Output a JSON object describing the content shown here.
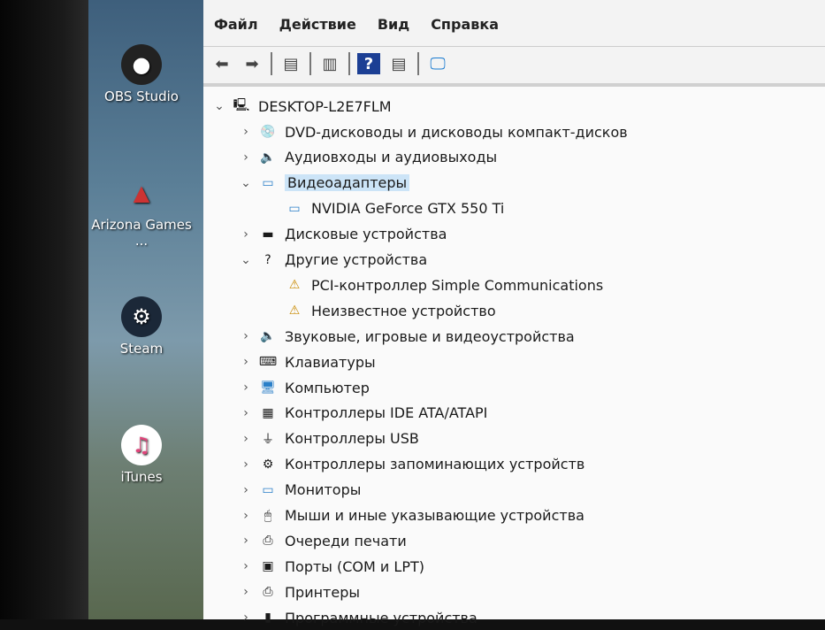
{
  "desktop": {
    "icons": [
      {
        "label": "OBS Studio",
        "icon": "obs-icon"
      },
      {
        "label": "Arizona Games ...",
        "icon": "arizona-icon"
      },
      {
        "label": "Steam",
        "icon": "steam-icon"
      },
      {
        "label": "iTunes",
        "icon": "itunes-icon"
      }
    ]
  },
  "menu": [
    "Файл",
    "Действие",
    "Вид",
    "Справка"
  ],
  "toolbar": [
    "back-icon",
    "forward-icon",
    "properties-icon",
    "show-hide-icon",
    "help-icon",
    "update-driver-icon",
    "scan-hardware-icon"
  ],
  "tree": {
    "root": "DESKTOP-L2E7FLM",
    "rows": [
      {
        "label": "DVD-дисководы и дисководы компакт-дисков",
        "level": 1,
        "expand": "collapsed",
        "icon": "dvd-icon",
        "glyph": "💿"
      },
      {
        "label": "Аудиовходы и аудиовыходы",
        "level": 1,
        "expand": "collapsed",
        "icon": "speaker-icon",
        "glyph": "🔈"
      },
      {
        "label": "Видеоадаптеры",
        "level": 1,
        "expand": "expanded",
        "icon": "display-adapter-icon",
        "glyph": "▭",
        "selected": true
      },
      {
        "label": "NVIDIA GeForce GTX 550 Ti",
        "level": 2,
        "icon": "display-adapter-icon",
        "glyph": "▭"
      },
      {
        "label": "Дисковые устройства",
        "level": 1,
        "expand": "collapsed",
        "icon": "disk-icon",
        "glyph": "▬"
      },
      {
        "label": "Другие устройства",
        "level": 1,
        "expand": "expanded",
        "icon": "unknown-device-icon",
        "glyph": "?"
      },
      {
        "label": "PCI-контроллер Simple Communications",
        "level": 2,
        "icon": "warning-device-icon",
        "glyph": "⚠"
      },
      {
        "label": "Неизвестное устройство",
        "level": 2,
        "icon": "warning-device-icon",
        "glyph": "⚠"
      },
      {
        "label": "Звуковые, игровые и видеоустройства",
        "level": 1,
        "expand": "collapsed",
        "icon": "speaker-icon",
        "glyph": "🔈"
      },
      {
        "label": "Клавиатуры",
        "level": 1,
        "expand": "collapsed",
        "icon": "keyboard-icon",
        "glyph": "⌨"
      },
      {
        "label": "Компьютер",
        "level": 1,
        "expand": "collapsed",
        "icon": "computer-icon",
        "glyph": "🖥"
      },
      {
        "label": "Контроллеры IDE ATA/ATAPI",
        "level": 1,
        "expand": "collapsed",
        "icon": "ide-controller-icon",
        "glyph": "▦"
      },
      {
        "label": "Контроллеры USB",
        "level": 1,
        "expand": "collapsed",
        "icon": "usb-icon",
        "glyph": "⏚"
      },
      {
        "label": "Контроллеры запоминающих устройств",
        "level": 1,
        "expand": "collapsed",
        "icon": "storage-controller-icon",
        "glyph": "⚙"
      },
      {
        "label": "Мониторы",
        "level": 1,
        "expand": "collapsed",
        "icon": "monitor-icon",
        "glyph": "▭"
      },
      {
        "label": "Мыши и иные указывающие устройства",
        "level": 1,
        "expand": "collapsed",
        "icon": "mouse-icon",
        "glyph": "🖱"
      },
      {
        "label": "Очереди печати",
        "level": 1,
        "expand": "collapsed",
        "icon": "print-queue-icon",
        "glyph": "⎙"
      },
      {
        "label": "Порты (COM и LPT)",
        "level": 1,
        "expand": "collapsed",
        "icon": "port-icon",
        "glyph": "▣"
      },
      {
        "label": "Принтеры",
        "level": 1,
        "expand": "collapsed",
        "icon": "printer-icon",
        "glyph": "⎙"
      },
      {
        "label": "Программные устройства",
        "level": 1,
        "expand": "collapsed",
        "icon": "software-device-icon",
        "glyph": "▮"
      }
    ]
  }
}
